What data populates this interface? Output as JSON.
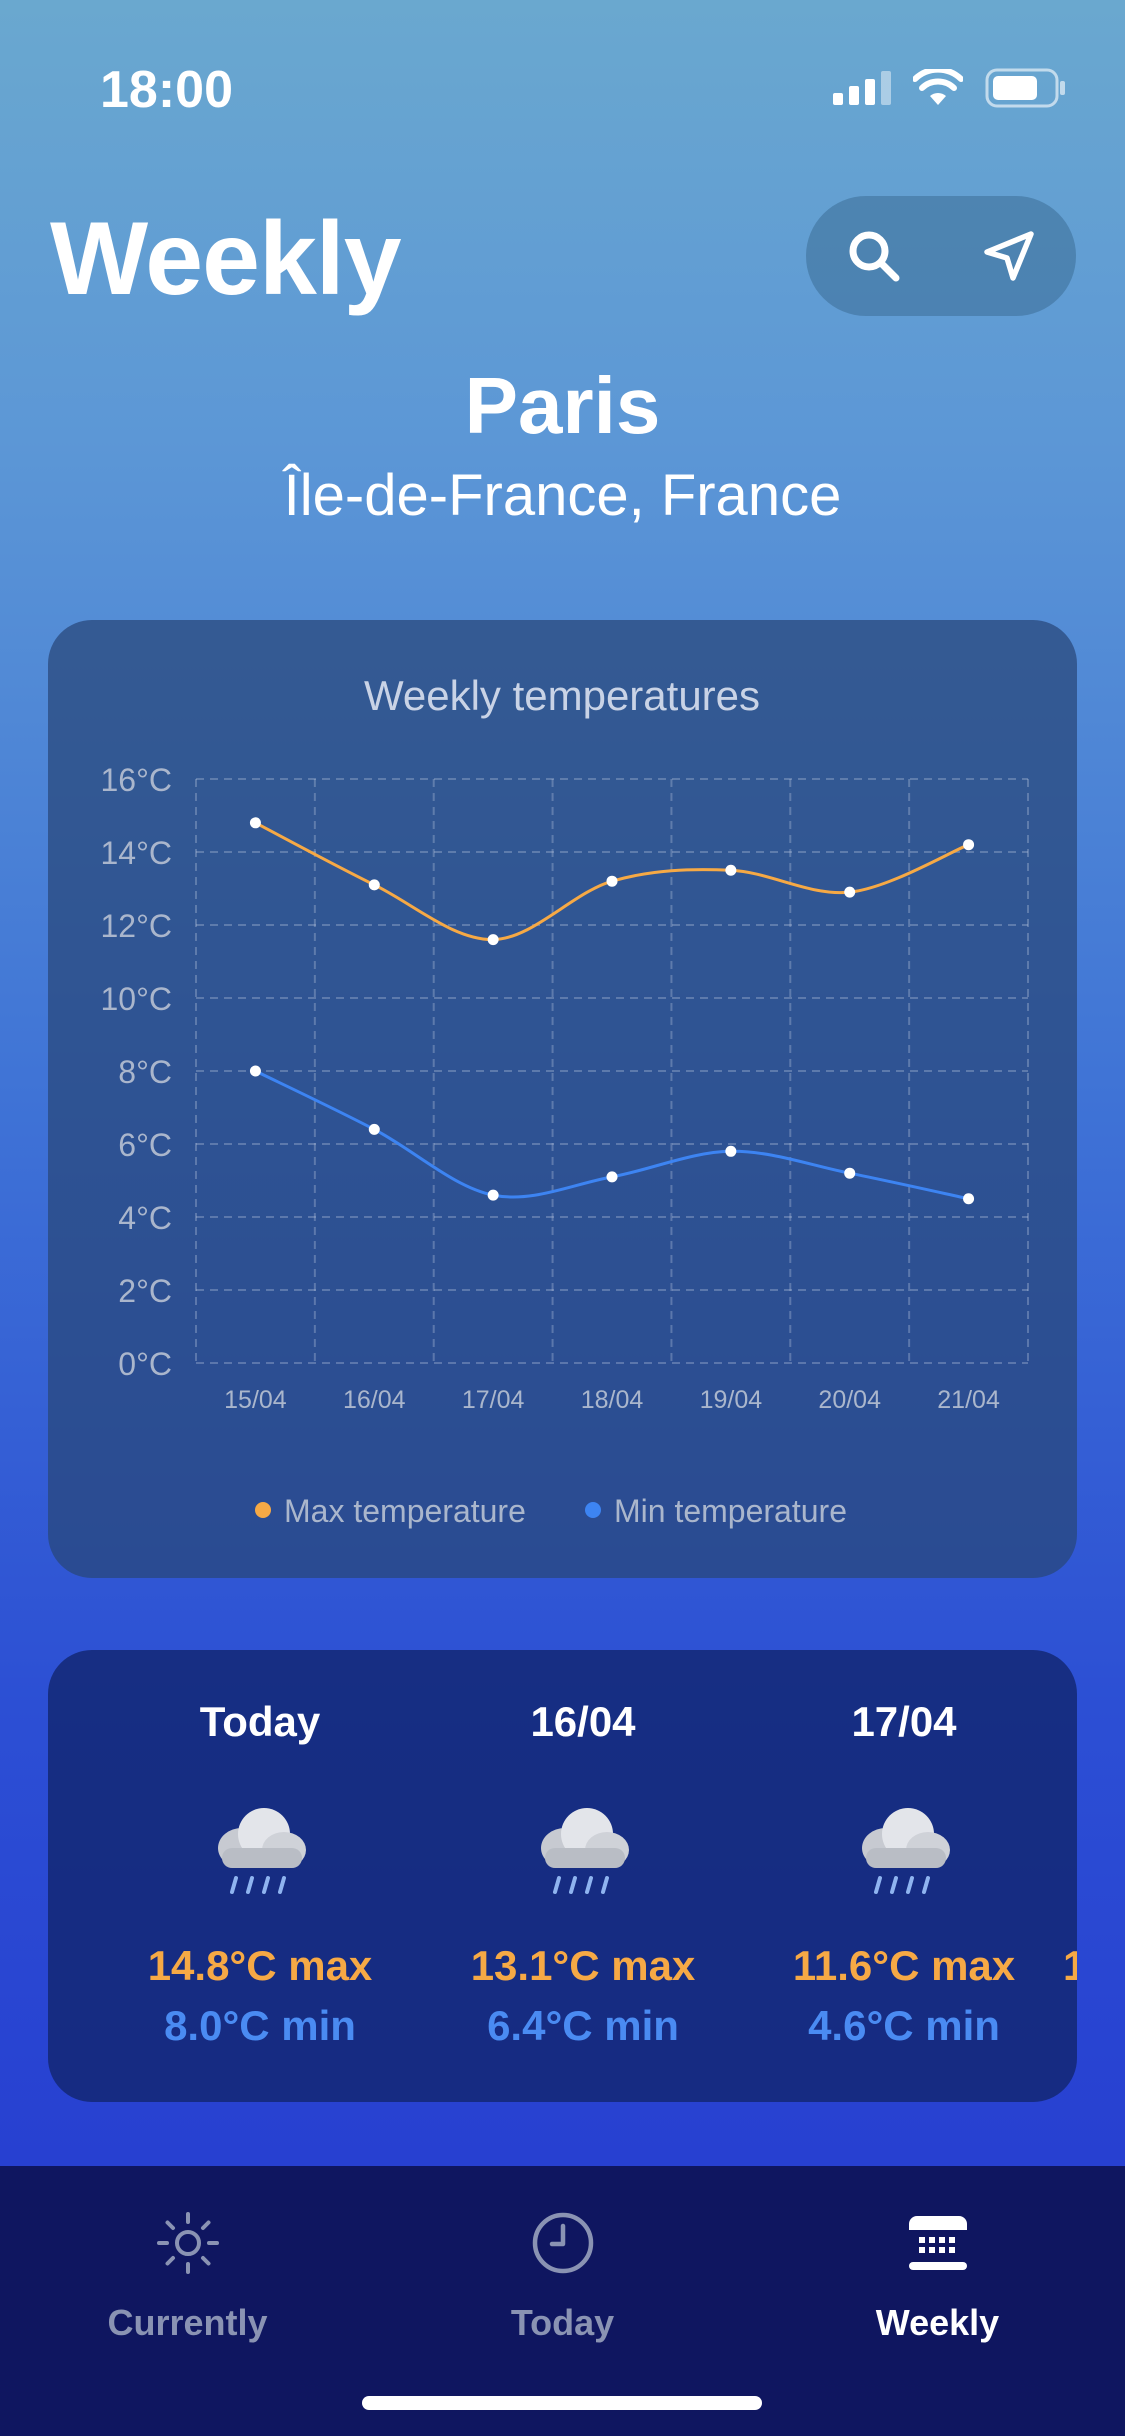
{
  "status": {
    "time": "18:00"
  },
  "header": {
    "title": "Weekly"
  },
  "location": {
    "city": "Paris",
    "region": "Île-de-France, France"
  },
  "chart_data": {
    "type": "line",
    "title": "Weekly temperatures",
    "categories": [
      "15/04",
      "16/04",
      "17/04",
      "18/04",
      "19/04",
      "20/04",
      "21/04"
    ],
    "y_ticks": [
      "0°C",
      "2°C",
      "4°C",
      "6°C",
      "8°C",
      "10°C",
      "12°C",
      "14°C",
      "16°C"
    ],
    "ylim": [
      0,
      16
    ],
    "grid": true,
    "legend_position": "bottom",
    "series": [
      {
        "name": "Max temperature",
        "color": "#f6a945",
        "values": [
          14.8,
          13.1,
          11.6,
          13.2,
          13.5,
          12.9,
          14.2
        ]
      },
      {
        "name": "Min temperature",
        "color": "#3d84f2",
        "values": [
          8.0,
          6.4,
          4.6,
          5.1,
          5.8,
          5.2,
          4.5
        ]
      }
    ]
  },
  "forecast": {
    "days": [
      {
        "label": "Today",
        "icon": "rain-cloud-icon",
        "max": "14.8°C max",
        "min": "8.0°C min"
      },
      {
        "label": "16/04",
        "icon": "rain-cloud-icon",
        "max": "13.1°C max",
        "min": "6.4°C min"
      },
      {
        "label": "17/04",
        "icon": "rain-cloud-icon",
        "max": "11.6°C max",
        "min": "4.6°C min"
      }
    ],
    "peek": "1"
  },
  "tabs": [
    {
      "label": "Currently",
      "icon": "sun-icon",
      "active": false
    },
    {
      "label": "Today",
      "icon": "clock-icon",
      "active": false
    },
    {
      "label": "Weekly",
      "icon": "calendar-icon",
      "active": true
    }
  ]
}
